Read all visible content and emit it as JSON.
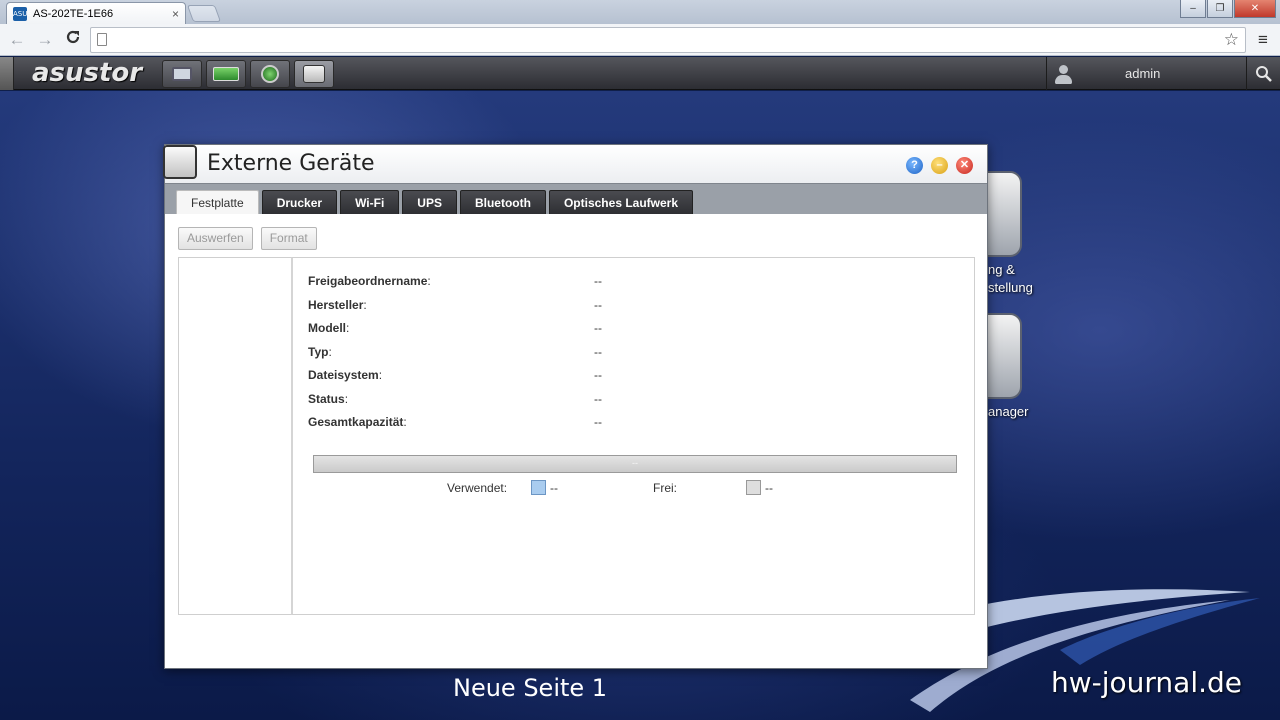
{
  "browser": {
    "tab_title": "AS-202TE-1E66",
    "tab_favicon_text": "ASUS",
    "close_symbol": "×",
    "window_buttons": [
      "‒",
      "❐",
      "✕"
    ],
    "address_value": "",
    "nav": {
      "back": "←",
      "forward": "→",
      "reload": "C"
    },
    "star": "☆",
    "menu": "≡"
  },
  "adm": {
    "logo": "asustor",
    "user": "admin",
    "search_icon": "🔍",
    "taskbar_icons": [
      "monitor-icon",
      "storage-icon",
      "settings-icon",
      "external-devices-icon"
    ]
  },
  "desktop": {
    "icon_labels": [
      "ng &",
      "stellung",
      "anager"
    ]
  },
  "window": {
    "title": "Externe Geräte",
    "controls": {
      "help": "?",
      "minimize": "–",
      "close": "✕"
    },
    "tabs": [
      "Festplatte",
      "Drucker",
      "Wi-Fi",
      "UPS",
      "Bluetooth",
      "Optisches Laufwerk"
    ],
    "active_tab": "Festplatte",
    "buttons": {
      "eject": "Auswerfen",
      "format": "Format"
    },
    "fields": [
      {
        "label": "Freigabeordnername",
        "value": "--"
      },
      {
        "label": "Hersteller",
        "value": "--"
      },
      {
        "label": "Modell",
        "value": "--"
      },
      {
        "label": "Typ",
        "value": "--"
      },
      {
        "label": "Dateisystem",
        "value": "--"
      },
      {
        "label": "Status",
        "value": "--"
      },
      {
        "label": "Gesamtkapazität",
        "value": "--"
      }
    ],
    "capacity_bar_text": "--",
    "legend": {
      "used_label": "Verwendet:",
      "used_value": "--",
      "free_label": "Frei:",
      "free_value": "--"
    }
  },
  "bottom_label": "Neue Seite 1",
  "watermark": "hw-journal.de",
  "colors": {
    "accent_blue": "#1e64c6",
    "desktop": "#1b2f6a",
    "used": "#a9ccef"
  }
}
